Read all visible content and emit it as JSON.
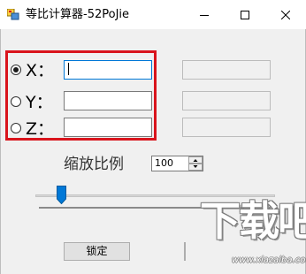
{
  "window": {
    "title": "等比计算器-52PoJie"
  },
  "title_icons": {
    "app": "app-icon",
    "minimize": "minimize-icon",
    "maximize": "maximize-icon",
    "close": "close-icon"
  },
  "radios": [
    {
      "label": "X：",
      "checked": true
    },
    {
      "label": "Y：",
      "checked": false
    },
    {
      "label": "Z：",
      "checked": false
    }
  ],
  "inputs": {
    "x": "",
    "y": "",
    "z": ""
  },
  "results": {
    "x": "",
    "y": "",
    "z": ""
  },
  "scale": {
    "label": "缩放比例",
    "value": "100"
  },
  "slider": {
    "position": 0.12
  },
  "buttons": {
    "lock": "锁定"
  },
  "watermark": {
    "logo": "下载吧",
    "url": "www.xiazaiba.com"
  },
  "colors": {
    "highlight": "#d9141c",
    "focus": "#0078d7",
    "thumb": "#0078d7"
  }
}
